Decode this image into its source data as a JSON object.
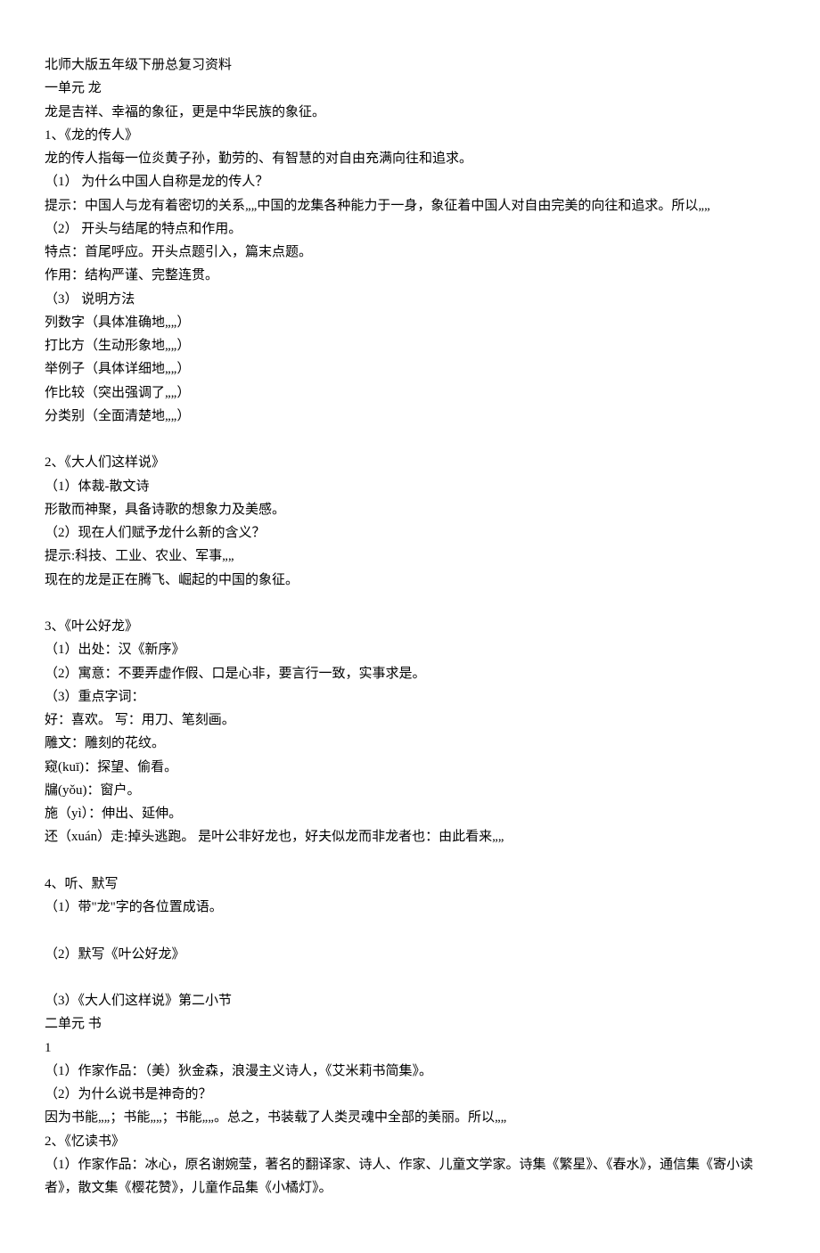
{
  "lines": [
    "北师大版五年级下册总复习资料",
    "一单元 龙",
    "龙是吉祥、幸福的象征，更是中华民族的象征。",
    "1、《龙的传人》",
    "龙的传人指每一位炎黄子孙，勤劳的、有智慧的对自由充满向往和追求。",
    "（1） 为什么中国人自称是龙的传人？",
    "提示：中国人与龙有着密切的关系„„中国的龙集各种能力于一身，象征着中国人对自由完美的向往和追求。所以„„",
    "（2） 开头与结尾的特点和作用。",
    "特点：首尾呼应。开头点题引入，篇末点题。",
    "作用：结构严谨、完整连贯。",
    "（3） 说明方法",
    "列数字（具体准确地„„）",
    "打比方（生动形象地„„）",
    "举例子（具体详细地„„）",
    "作比较（突出强调了„„）",
    "分类别（全面清楚地„„）",
    "",
    "2、《大人们这样说》",
    "（1）体裁-散文诗",
    "形散而神聚，具备诗歌的想象力及美感。",
    "（2）现在人们赋予龙什么新的含义？",
    "提示:科技、工业、农业、军事„„",
    "现在的龙是正在腾飞、崛起的中国的象征。",
    "",
    "3、《叶公好龙》",
    "（1）出处：汉《新序》",
    "（2）寓意：不要弄虚作假、口是心非，要言行一致，实事求是。",
    "（3）重点字词：",
    "好：喜欢。  写：用刀、笔刻画。",
    "雕文：雕刻的花纹。",
    "窥(kuī)：探望、偷看。",
    "牖(yǒu)：窗户。",
    "施（yì）：伸出、延伸。",
    "还（xuán）走:掉头逃跑。  是叶公非好龙也，好夫似龙而非龙者也：由此看来„„",
    "",
    "4、听、默写",
    "（1）带\"龙\"字的各位置成语。",
    "",
    "（2）默写《叶公好龙》",
    "",
    "（3）《大人们这样说》第二小节",
    "二单元  书",
    "1",
    "（1）作家作品：（美）狄金森，浪漫主义诗人，《艾米莉书简集》。",
    "（2）为什么说书是神奇的？",
    "因为书能„„；书能„„；书能„„。总之，书装载了人类灵魂中全部的美丽。所以„„",
    "2、《忆读书》",
    "（1）作家作品：冰心，原名谢婉莹，著名的翻译家、诗人、作家、儿童文学家。诗集《繁星》、《春水》，通信集《寄小读者》，散文集《樱花赞》，儿童作品集《小橘灯》。"
  ]
}
